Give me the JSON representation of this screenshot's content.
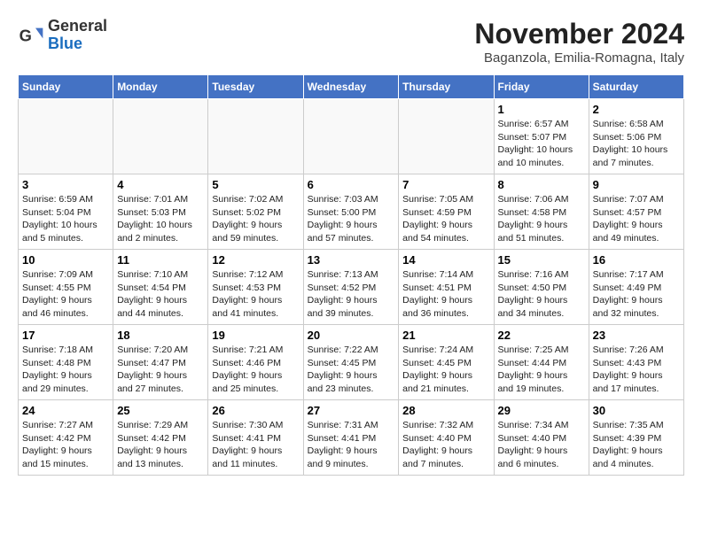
{
  "header": {
    "logo_general": "General",
    "logo_blue": "Blue",
    "month_title": "November 2024",
    "subtitle": "Baganzola, Emilia-Romagna, Italy"
  },
  "weekdays": [
    "Sunday",
    "Monday",
    "Tuesday",
    "Wednesday",
    "Thursday",
    "Friday",
    "Saturday"
  ],
  "weeks": [
    [
      {
        "day": "",
        "info": ""
      },
      {
        "day": "",
        "info": ""
      },
      {
        "day": "",
        "info": ""
      },
      {
        "day": "",
        "info": ""
      },
      {
        "day": "",
        "info": ""
      },
      {
        "day": "1",
        "info": "Sunrise: 6:57 AM\nSunset: 5:07 PM\nDaylight: 10 hours and 10 minutes."
      },
      {
        "day": "2",
        "info": "Sunrise: 6:58 AM\nSunset: 5:06 PM\nDaylight: 10 hours and 7 minutes."
      }
    ],
    [
      {
        "day": "3",
        "info": "Sunrise: 6:59 AM\nSunset: 5:04 PM\nDaylight: 10 hours and 5 minutes."
      },
      {
        "day": "4",
        "info": "Sunrise: 7:01 AM\nSunset: 5:03 PM\nDaylight: 10 hours and 2 minutes."
      },
      {
        "day": "5",
        "info": "Sunrise: 7:02 AM\nSunset: 5:02 PM\nDaylight: 9 hours and 59 minutes."
      },
      {
        "day": "6",
        "info": "Sunrise: 7:03 AM\nSunset: 5:00 PM\nDaylight: 9 hours and 57 minutes."
      },
      {
        "day": "7",
        "info": "Sunrise: 7:05 AM\nSunset: 4:59 PM\nDaylight: 9 hours and 54 minutes."
      },
      {
        "day": "8",
        "info": "Sunrise: 7:06 AM\nSunset: 4:58 PM\nDaylight: 9 hours and 51 minutes."
      },
      {
        "day": "9",
        "info": "Sunrise: 7:07 AM\nSunset: 4:57 PM\nDaylight: 9 hours and 49 minutes."
      }
    ],
    [
      {
        "day": "10",
        "info": "Sunrise: 7:09 AM\nSunset: 4:55 PM\nDaylight: 9 hours and 46 minutes."
      },
      {
        "day": "11",
        "info": "Sunrise: 7:10 AM\nSunset: 4:54 PM\nDaylight: 9 hours and 44 minutes."
      },
      {
        "day": "12",
        "info": "Sunrise: 7:12 AM\nSunset: 4:53 PM\nDaylight: 9 hours and 41 minutes."
      },
      {
        "day": "13",
        "info": "Sunrise: 7:13 AM\nSunset: 4:52 PM\nDaylight: 9 hours and 39 minutes."
      },
      {
        "day": "14",
        "info": "Sunrise: 7:14 AM\nSunset: 4:51 PM\nDaylight: 9 hours and 36 minutes."
      },
      {
        "day": "15",
        "info": "Sunrise: 7:16 AM\nSunset: 4:50 PM\nDaylight: 9 hours and 34 minutes."
      },
      {
        "day": "16",
        "info": "Sunrise: 7:17 AM\nSunset: 4:49 PM\nDaylight: 9 hours and 32 minutes."
      }
    ],
    [
      {
        "day": "17",
        "info": "Sunrise: 7:18 AM\nSunset: 4:48 PM\nDaylight: 9 hours and 29 minutes."
      },
      {
        "day": "18",
        "info": "Sunrise: 7:20 AM\nSunset: 4:47 PM\nDaylight: 9 hours and 27 minutes."
      },
      {
        "day": "19",
        "info": "Sunrise: 7:21 AM\nSunset: 4:46 PM\nDaylight: 9 hours and 25 minutes."
      },
      {
        "day": "20",
        "info": "Sunrise: 7:22 AM\nSunset: 4:45 PM\nDaylight: 9 hours and 23 minutes."
      },
      {
        "day": "21",
        "info": "Sunrise: 7:24 AM\nSunset: 4:45 PM\nDaylight: 9 hours and 21 minutes."
      },
      {
        "day": "22",
        "info": "Sunrise: 7:25 AM\nSunset: 4:44 PM\nDaylight: 9 hours and 19 minutes."
      },
      {
        "day": "23",
        "info": "Sunrise: 7:26 AM\nSunset: 4:43 PM\nDaylight: 9 hours and 17 minutes."
      }
    ],
    [
      {
        "day": "24",
        "info": "Sunrise: 7:27 AM\nSunset: 4:42 PM\nDaylight: 9 hours and 15 minutes."
      },
      {
        "day": "25",
        "info": "Sunrise: 7:29 AM\nSunset: 4:42 PM\nDaylight: 9 hours and 13 minutes."
      },
      {
        "day": "26",
        "info": "Sunrise: 7:30 AM\nSunset: 4:41 PM\nDaylight: 9 hours and 11 minutes."
      },
      {
        "day": "27",
        "info": "Sunrise: 7:31 AM\nSunset: 4:41 PM\nDaylight: 9 hours and 9 minutes."
      },
      {
        "day": "28",
        "info": "Sunrise: 7:32 AM\nSunset: 4:40 PM\nDaylight: 9 hours and 7 minutes."
      },
      {
        "day": "29",
        "info": "Sunrise: 7:34 AM\nSunset: 4:40 PM\nDaylight: 9 hours and 6 minutes."
      },
      {
        "day": "30",
        "info": "Sunrise: 7:35 AM\nSunset: 4:39 PM\nDaylight: 9 hours and 4 minutes."
      }
    ]
  ]
}
